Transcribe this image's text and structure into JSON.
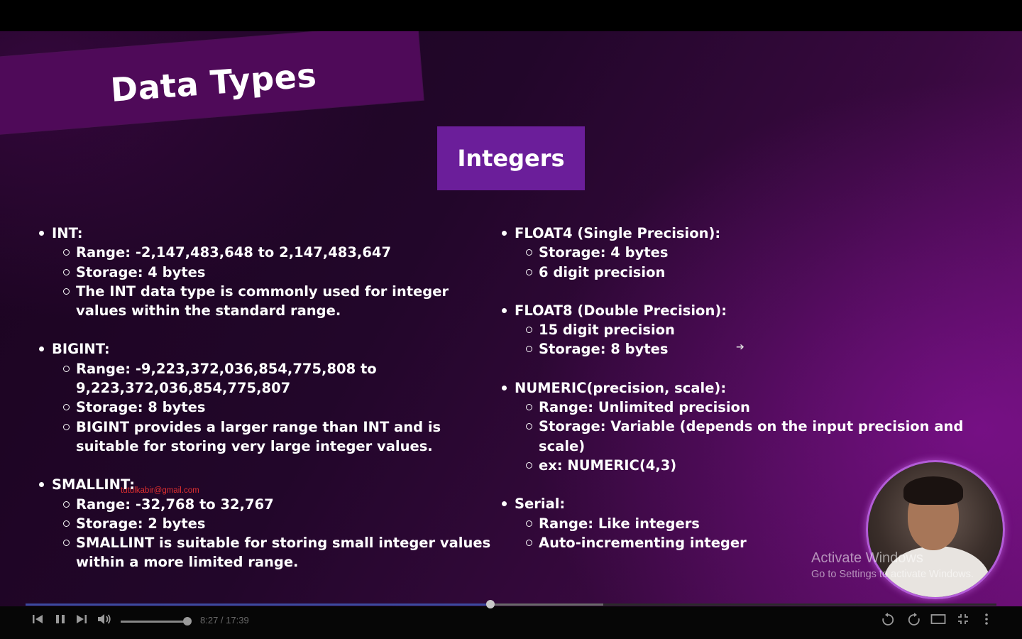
{
  "slide": {
    "title": "Data Types",
    "section": "Integers",
    "left_column": [
      {
        "heading": "INT:",
        "items": [
          "Range: -2,147,483,648 to 2,147,483,647",
          "Storage: 4 bytes",
          "The INT data type is commonly used for integer values within the standard range."
        ]
      },
      {
        "heading": "BIGINT:",
        "items": [
          "Range: -9,223,372,036,854,775,808 to 9,223,372,036,854,775,807",
          "Storage: 8 bytes",
          "BIGINT provides a larger range than INT and is suitable for storing very large integer values."
        ]
      },
      {
        "heading": "SMALLINT:",
        "items": [
          "Range: -32,768 to 32,767",
          "Storage: 2 bytes",
          "SMALLINT is suitable for storing small integer values within a more limited range."
        ]
      }
    ],
    "right_column": [
      {
        "heading": "FLOAT4 (Single Precision):",
        "items": [
          "Storage: 4 bytes",
          "6 digit precision"
        ]
      },
      {
        "heading": "FLOAT8 (Double Precision):",
        "items": [
          "15 digit precision",
          "Storage: 8 bytes"
        ]
      },
      {
        "heading": "NUMERIC(precision, scale):",
        "items": [
          "Range: Unlimited precision",
          "Storage: Variable (depends on the input precision and scale)",
          "ex: NUMERIC(4,3)"
        ]
      },
      {
        "heading": "Serial:",
        "items": [
          "Range: Like integers",
          "Auto-incrementing integer"
        ]
      }
    ],
    "watermark_email": "tutulkabir@gmail.com"
  },
  "os_overlay": {
    "line1": "Activate Windows",
    "line2": "Go to Settings to activate Windows."
  },
  "player": {
    "current_time": "8:27",
    "duration": "17:39",
    "time_display": "8:27 / 17:39",
    "played_fraction": 0.479,
    "buffered_fraction": 0.595,
    "volume_fraction": 0.94,
    "icons": {
      "previous": "skip-previous-icon",
      "pause": "pause-icon",
      "next": "skip-next-icon",
      "volume": "volume-icon",
      "rewind": "rewind-10-icon",
      "forward": "forward-10-icon",
      "theater": "theater-mode-icon",
      "fullscreen": "exit-fullscreen-icon",
      "more": "more-vertical-icon"
    }
  },
  "colors": {
    "title_band": "#4f0a59",
    "section_box": "#6b1e9a",
    "progress": "#3c4aa0",
    "email": "#e03030"
  }
}
